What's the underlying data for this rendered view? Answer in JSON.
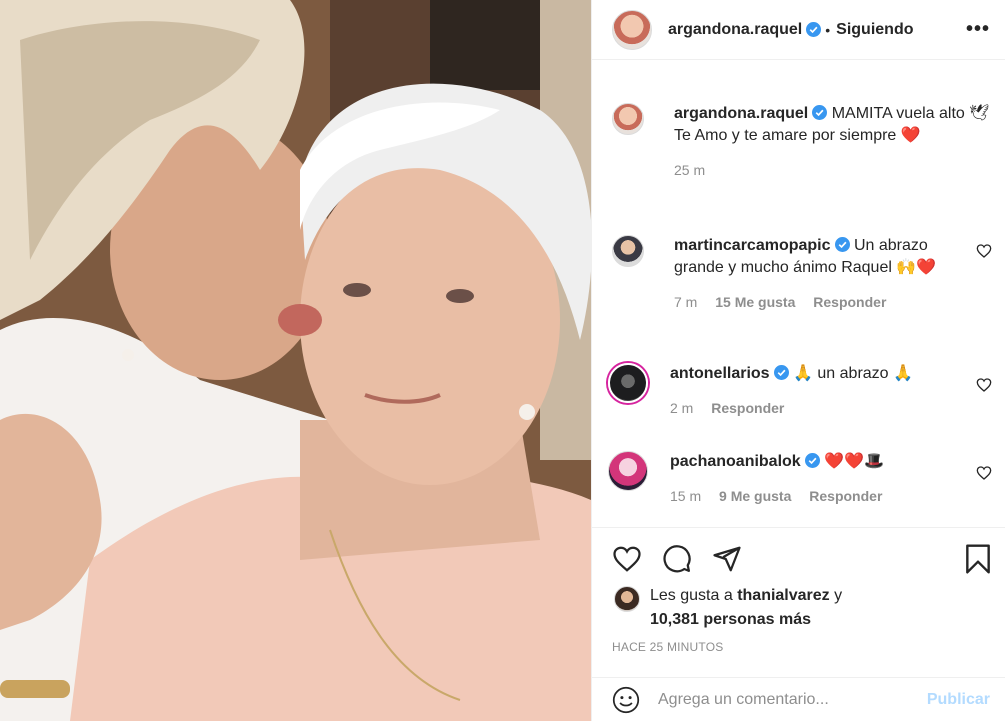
{
  "post": {
    "author": "argandona.raquel",
    "follow_status": "Siguiendo",
    "separator": "•",
    "more_label": "•••"
  },
  "caption": {
    "user": "argandona.raquel",
    "line1": "MAMITA vuela alto 🕊",
    "line2": "Te Amo y te amare por siempre ❤️",
    "time": "25 m"
  },
  "comments": [
    {
      "user": "martincarcamopapic",
      "text": "Un abrazo grande y mucho ánimo Raquel 🙌❤️",
      "time": "7 m",
      "likes": "15 Me gusta",
      "reply": "Responder"
    },
    {
      "user": "antonellarios",
      "text": "🙏 un abrazo 🙏",
      "time": "2 m",
      "reply": "Responder"
    },
    {
      "user": "pachanoanibalok",
      "text": "❤️❤️🎩",
      "time": "15 m",
      "likes": "9 Me gusta",
      "reply": "Responder"
    }
  ],
  "likes": {
    "prefix": "Les gusta a",
    "user": "thanialvarez",
    "suffix": "y",
    "count": "10,381 personas más"
  },
  "timestamp": "HACE 25 MINUTOS",
  "composer": {
    "placeholder": "Agrega un comentario...",
    "publish": "Publicar"
  },
  "icons": [
    "heart-icon",
    "comment-icon",
    "share-icon",
    "bookmark-icon",
    "emoji-icon",
    "verified-icon",
    "more-icon"
  ],
  "colors": {
    "verified": "#3897f0",
    "publish": "#b3dbff",
    "muted": "#8e8e8e"
  }
}
